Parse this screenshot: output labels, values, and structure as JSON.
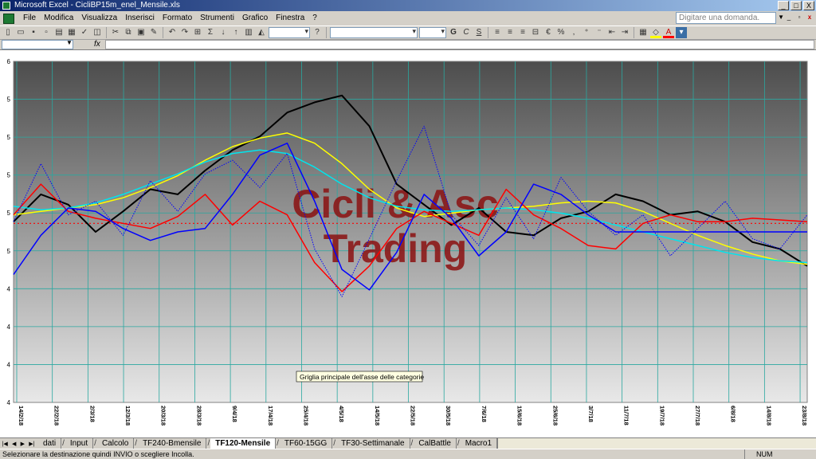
{
  "window": {
    "title": "Microsoft Excel - CicliBP15m_enel_Mensile.xls",
    "minimize": "_",
    "maximize": "□",
    "close": "X"
  },
  "menu": [
    "File",
    "Modifica",
    "Visualizza",
    "Inserisci",
    "Formato",
    "Strumenti",
    "Grafico",
    "Finestra",
    "?"
  ],
  "ask_box": {
    "placeholder": "Digitare una domanda."
  },
  "formula_bar": {
    "fx": "fx",
    "value": ""
  },
  "toolbar": {
    "bold": "G",
    "italic": "C",
    "underline": "S"
  },
  "chart_data": {
    "type": "line",
    "watermark": [
      "Cicli & Asc",
      "Trading"
    ],
    "tooltip": "Griglia principale dell'asse delle categorie",
    "ytick_labels": [
      "6",
      "5",
      "5",
      "5",
      "5",
      "5",
      "4",
      "4",
      "4",
      "4"
    ],
    "ylim": [
      4.0,
      6.0
    ],
    "grid": true,
    "x_dates": [
      "14/2/18",
      "22/2/18",
      "2/3/18",
      "12/3/18",
      "20/3/18",
      "28/3/18",
      "9/4/18",
      "17/4/18",
      "25/4/18",
      "4/5/18",
      "14/5/18",
      "22/5/18",
      "30/5/18",
      "7/6/18",
      "15/6/18",
      "25/6/18",
      "3/7/18",
      "11/7/18",
      "19/7/18",
      "27/7/18",
      "6/8/18",
      "14/8/18",
      "23/8/18"
    ],
    "reference_line": {
      "value": 5.05,
      "color": "#ff0000",
      "style": "dotted"
    },
    "series": [
      {
        "color": "#000000",
        "values": [
          5.06,
          5.22,
          5.16,
          5.0,
          5.12,
          5.25,
          5.22,
          5.36,
          5.48,
          5.56,
          5.7,
          5.76,
          5.8,
          5.62,
          5.28,
          5.16,
          5.04,
          5.14,
          5.0,
          4.98,
          5.08,
          5.12,
          5.22,
          5.18,
          5.1,
          5.12,
          5.06,
          4.94,
          4.9,
          4.8
        ]
      },
      {
        "color": "#ffff00",
        "values": [
          5.1,
          5.12,
          5.14,
          5.16,
          5.2,
          5.26,
          5.33,
          5.42,
          5.5,
          5.55,
          5.58,
          5.52,
          5.4,
          5.25,
          5.14,
          5.09,
          5.11,
          5.13,
          5.14,
          5.15,
          5.17,
          5.18,
          5.17,
          5.12,
          5.05,
          4.98,
          4.92,
          4.87,
          4.83,
          4.81
        ]
      },
      {
        "color": "#00e5ee",
        "values": [
          5.15,
          5.13,
          5.14,
          5.17,
          5.22,
          5.28,
          5.34,
          5.41,
          5.46,
          5.48,
          5.46,
          5.38,
          5.28,
          5.2,
          5.15,
          5.13,
          5.12,
          5.13,
          5.14,
          5.13,
          5.11,
          5.08,
          5.04,
          5.0,
          4.96,
          4.92,
          4.88,
          4.85,
          4.83,
          4.82
        ]
      },
      {
        "color": "#ff0000",
        "values": [
          5.1,
          5.28,
          5.12,
          5.08,
          5.05,
          5.02,
          5.09,
          5.22,
          5.04,
          5.18,
          5.1,
          4.82,
          4.65,
          4.8,
          5.02,
          5.12,
          5.05,
          4.98,
          5.25,
          5.1,
          5.02,
          4.92,
          4.9,
          5.05,
          5.1,
          5.06,
          5.06,
          5.08,
          5.07,
          5.06
        ]
      },
      {
        "color": "#0000ff",
        "values": [
          4.75,
          4.98,
          5.14,
          5.12,
          5.02,
          4.95,
          5.0,
          5.02,
          5.22,
          5.45,
          5.52,
          5.18,
          4.78,
          4.66,
          4.88,
          5.22,
          5.08,
          4.86,
          5.0,
          5.28,
          5.22,
          5.1,
          5.0,
          5.0,
          5.0,
          5.0,
          5.0,
          5.0,
          5.0,
          5.0
        ]
      },
      {
        "color": "#0000ff",
        "style": "dotted",
        "values": [
          5.06,
          5.4,
          5.1,
          5.18,
          4.98,
          5.3,
          5.12,
          5.34,
          5.42,
          5.26,
          5.46,
          4.9,
          4.62,
          4.96,
          5.3,
          5.62,
          5.1,
          4.92,
          5.2,
          4.96,
          5.32,
          5.12,
          4.98,
          5.1,
          4.86,
          5.02,
          5.18,
          4.96,
          4.9,
          5.1
        ]
      }
    ]
  },
  "sheet_tabs": [
    "dati",
    "Input",
    "Calcolo",
    "TF240-Bmensile",
    "TF120-Mensile",
    "TF60-15GG",
    "TF30-Settimanale",
    "CalBattle",
    "Macro1"
  ],
  "active_tab": "TF120-Mensile",
  "status": {
    "message": "Selezionare la destinazione quindi INVIO o scegliere Incolla.",
    "indicator": "NUM"
  },
  "colors": {
    "plot_top": "#4d4d4d",
    "plot_bottom": "#e8e8e8",
    "watermark": "#8b1010",
    "grid": "#2aa8a0"
  }
}
